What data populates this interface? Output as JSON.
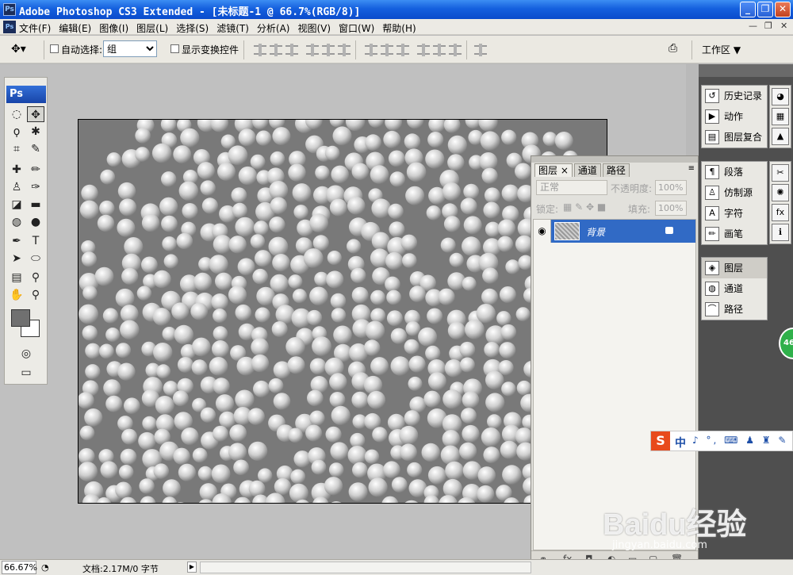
{
  "window": {
    "app_icon": "Ps",
    "title": "Adobe Photoshop CS3 Extended - [未标题-1 @ 66.7%(RGB/8)]",
    "buttons": {
      "minimize": "_",
      "maximize": "❐",
      "close": "✕"
    }
  },
  "menubar": {
    "items": [
      "文件(F)",
      "编辑(E)",
      "图像(I)",
      "图层(L)",
      "选择(S)",
      "滤镜(T)",
      "分析(A)",
      "视图(V)",
      "窗口(W)",
      "帮助(H)"
    ],
    "doc_controls": [
      "—",
      "❐",
      "✕"
    ]
  },
  "options": {
    "auto_select_label": "自动选择:",
    "auto_select_value": "组",
    "show_transform_label": "显示变换控件",
    "workspace_label": "工作区 ▼"
  },
  "toolbox": {
    "logo": "Ps",
    "foreground_color": "#707070",
    "background_color": "#ffffff"
  },
  "layers_panel": {
    "tabs": [
      "图层 ×",
      "通道",
      "路径"
    ],
    "blend_mode": "正常",
    "opacity_label": "不透明度:",
    "opacity_value": "100%",
    "lock_label": "锁定:",
    "fill_label": "填充:",
    "fill_value": "100%",
    "layers": [
      {
        "name": "背景",
        "visible": true,
        "locked": true
      }
    ],
    "bottom_icons": [
      "link-icon",
      "fx-icon",
      "mask-icon",
      "adjustment-icon",
      "folder-icon",
      "new-layer-icon",
      "trash-icon"
    ]
  },
  "dock": {
    "group1": [
      "历史记录",
      "动作",
      "图层复合"
    ],
    "group2": [
      "段落",
      "仿制源",
      "字符",
      "画笔"
    ],
    "group3": [
      "图层",
      "通道",
      "路径"
    ],
    "selected": "图层"
  },
  "badge": "46",
  "ime": {
    "logo": "S",
    "lang": "中",
    "icons": "♪ °, ⌨ ♟ ♜ ✎"
  },
  "status": {
    "zoom": "66.67%",
    "doc_info": "文档:2.17M/0 字节"
  },
  "watermark": {
    "brand": "Baidu经验",
    "site": "jingyan.baidu.com"
  }
}
